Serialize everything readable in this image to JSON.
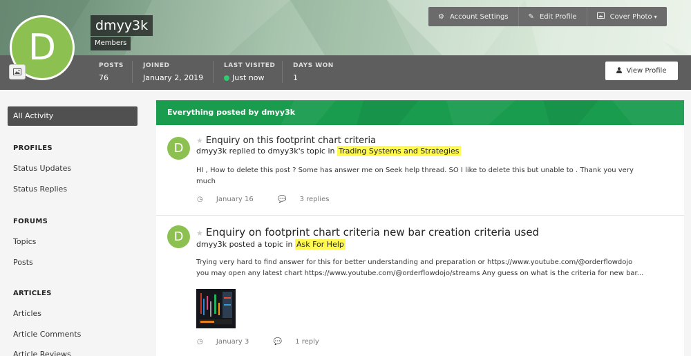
{
  "profile": {
    "avatar_letter": "D",
    "username": "dmyy3k",
    "group": "Members",
    "stats": [
      {
        "label": "POSTS",
        "value": "76"
      },
      {
        "label": "JOINED",
        "value": "January 2, 2019"
      },
      {
        "label": "LAST VISITED",
        "value": "Just now"
      },
      {
        "label": "DAYS WON",
        "value": "1"
      }
    ]
  },
  "header_buttons": {
    "account_settings": "Account Settings",
    "edit_profile": "Edit Profile",
    "cover_photo": "Cover Photo",
    "view_profile": "View Profile"
  },
  "sidebar": {
    "active": "All Activity",
    "sections": [
      {
        "title": "PROFILES",
        "items": [
          "Status Updates",
          "Status Replies"
        ]
      },
      {
        "title": "FORUMS",
        "items": [
          "Topics",
          "Posts"
        ]
      },
      {
        "title": "ARTICLES",
        "items": [
          "Articles",
          "Article Comments",
          "Article Reviews"
        ]
      }
    ]
  },
  "feed": {
    "header": "Everything posted by dmyy3k",
    "entries": [
      {
        "avatar_letter": "D",
        "title": "Enquiry on this footprint chart criteria",
        "meta_prefix": "dmyy3k replied to dmyy3k's topic in",
        "forum": "Trading Systems and Strategies",
        "body_line1": "HI , How to delete this post ? Some has answer me on Seek help thread. SO I like to delete this but unable to . Thank you very",
        "body_line2": "much",
        "date": "January 16",
        "replies": "3 replies"
      },
      {
        "avatar_letter": "D",
        "title": "Enquiry on footprint chart criteria new bar creation criteria used",
        "meta_prefix": "dmyy3k posted a topic in",
        "forum": "Ask For Help",
        "body_line1": "Trying very hard to find answer for this for better understanding and preparation or https://www.youtube.com/@orderflowdojo",
        "body_line2": "you may open any latest chart https://www.youtube.com/@orderflowdojo/streams Any guess on what is the criteria for new bar...",
        "date": "January 3",
        "replies": "1 reply"
      }
    ]
  },
  "colors": {
    "accent_green": "#1a9c4e",
    "avatar_green": "#8cc152",
    "highlight": "#fff950",
    "stats_bar": "#5e5e5e"
  },
  "icons": [
    "gear-icon",
    "pencil-icon",
    "image-icon",
    "caret-down-icon",
    "user-icon",
    "star-icon",
    "clock-icon",
    "comment-icon",
    "cover-photo-icon"
  ]
}
